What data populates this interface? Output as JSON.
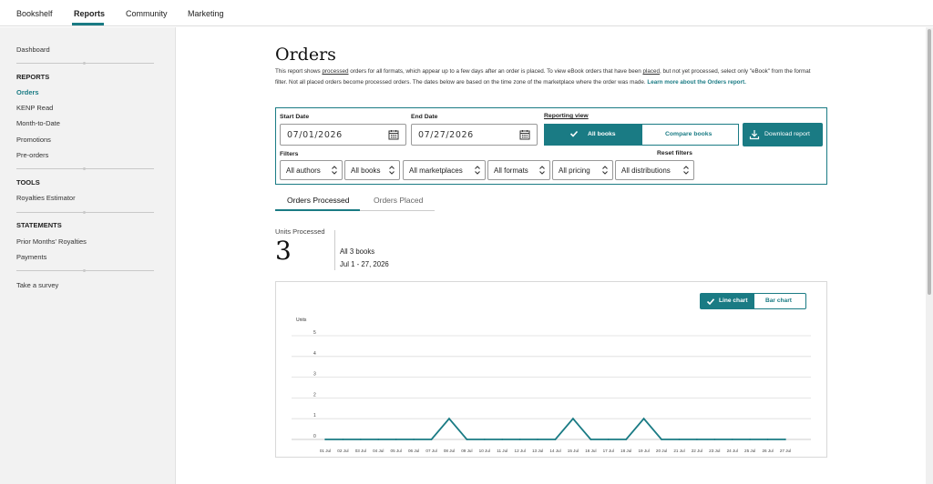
{
  "topnav": {
    "tabs": [
      {
        "label": "Bookshelf"
      },
      {
        "label": "Reports"
      },
      {
        "label": "Community"
      },
      {
        "label": "Marketing"
      }
    ],
    "active": "Reports"
  },
  "sidebar": {
    "dashboard": "Dashboard",
    "reports_heading": "REPORTS",
    "reports_items": [
      "Orders",
      "KENP Read",
      "Month-to-Date",
      "Promotions",
      "Pre-orders"
    ],
    "tools_heading": "TOOLS",
    "tools_items": [
      "Royalties Estimator"
    ],
    "statements_heading": "STATEMENTS",
    "statements_items": [
      "Prior Months' Royalties",
      "Payments"
    ],
    "survey": "Take a survey"
  },
  "page": {
    "title": "Orders",
    "desc_1": "This report shows ",
    "desc_processed": "processed",
    "desc_2": " orders for all formats, which appear up to a few days after an order is placed. To view eBook orders that have been ",
    "desc_placed": "placed",
    "desc_3": ", but not yet processed, select only \"eBook\" from the format filter. Not all placed orders become processed orders. The dates below are based on the time zone of the marketplace where the order was made. ",
    "desc_link": "Learn more about the Orders report."
  },
  "filters": {
    "start_label": "Start Date",
    "start_value": "07/01/2026",
    "end_label": "End Date",
    "end_value": "07/27/2026",
    "reporting_view_label": "Reporting view",
    "view_all": "All books",
    "view_compare": "Compare books",
    "download": "Download report",
    "filters_label": "Filters",
    "reset": "Reset filters",
    "selects": [
      "All authors",
      "All books",
      "All marketplaces",
      "All formats",
      "All pricing",
      "All distributions"
    ]
  },
  "subtabs": {
    "processed": "Orders Processed",
    "placed": "Orders Placed"
  },
  "summary": {
    "label": "Units Processed",
    "value": "3",
    "books": "All 3 books",
    "range": "Jul 1 - 27, 2026"
  },
  "chart_switch": {
    "line": "Line chart",
    "bar": "Bar chart"
  },
  "colors": {
    "accent": "#1a7b84"
  },
  "chart_data": {
    "type": "line",
    "ylabel": "Units",
    "ylim": [
      0,
      5
    ],
    "yticks": [
      "0",
      "1",
      "2",
      "3",
      "4",
      "5"
    ],
    "categories": [
      "01 Jul",
      "02 Jul",
      "03 Jul",
      "04 Jul",
      "05 Jul",
      "06 Jul",
      "07 Jul",
      "08 Jul",
      "09 Jul",
      "10 Jul",
      "11 Jul",
      "12 Jul",
      "13 Jul",
      "14 Jul",
      "15 Jul",
      "16 Jul",
      "17 Jul",
      "18 Jul",
      "19 Jul",
      "20 Jul",
      "21 Jul",
      "22 Jul",
      "23 Jul",
      "24 Jul",
      "25 Jul",
      "26 Jul",
      "27 Jul"
    ],
    "values": [
      0,
      0,
      0,
      0,
      0,
      0,
      0,
      1,
      0,
      0,
      0,
      0,
      0,
      0,
      1,
      0,
      0,
      0,
      1,
      0,
      0,
      0,
      0,
      0,
      0,
      0,
      0
    ],
    "grid": true
  }
}
